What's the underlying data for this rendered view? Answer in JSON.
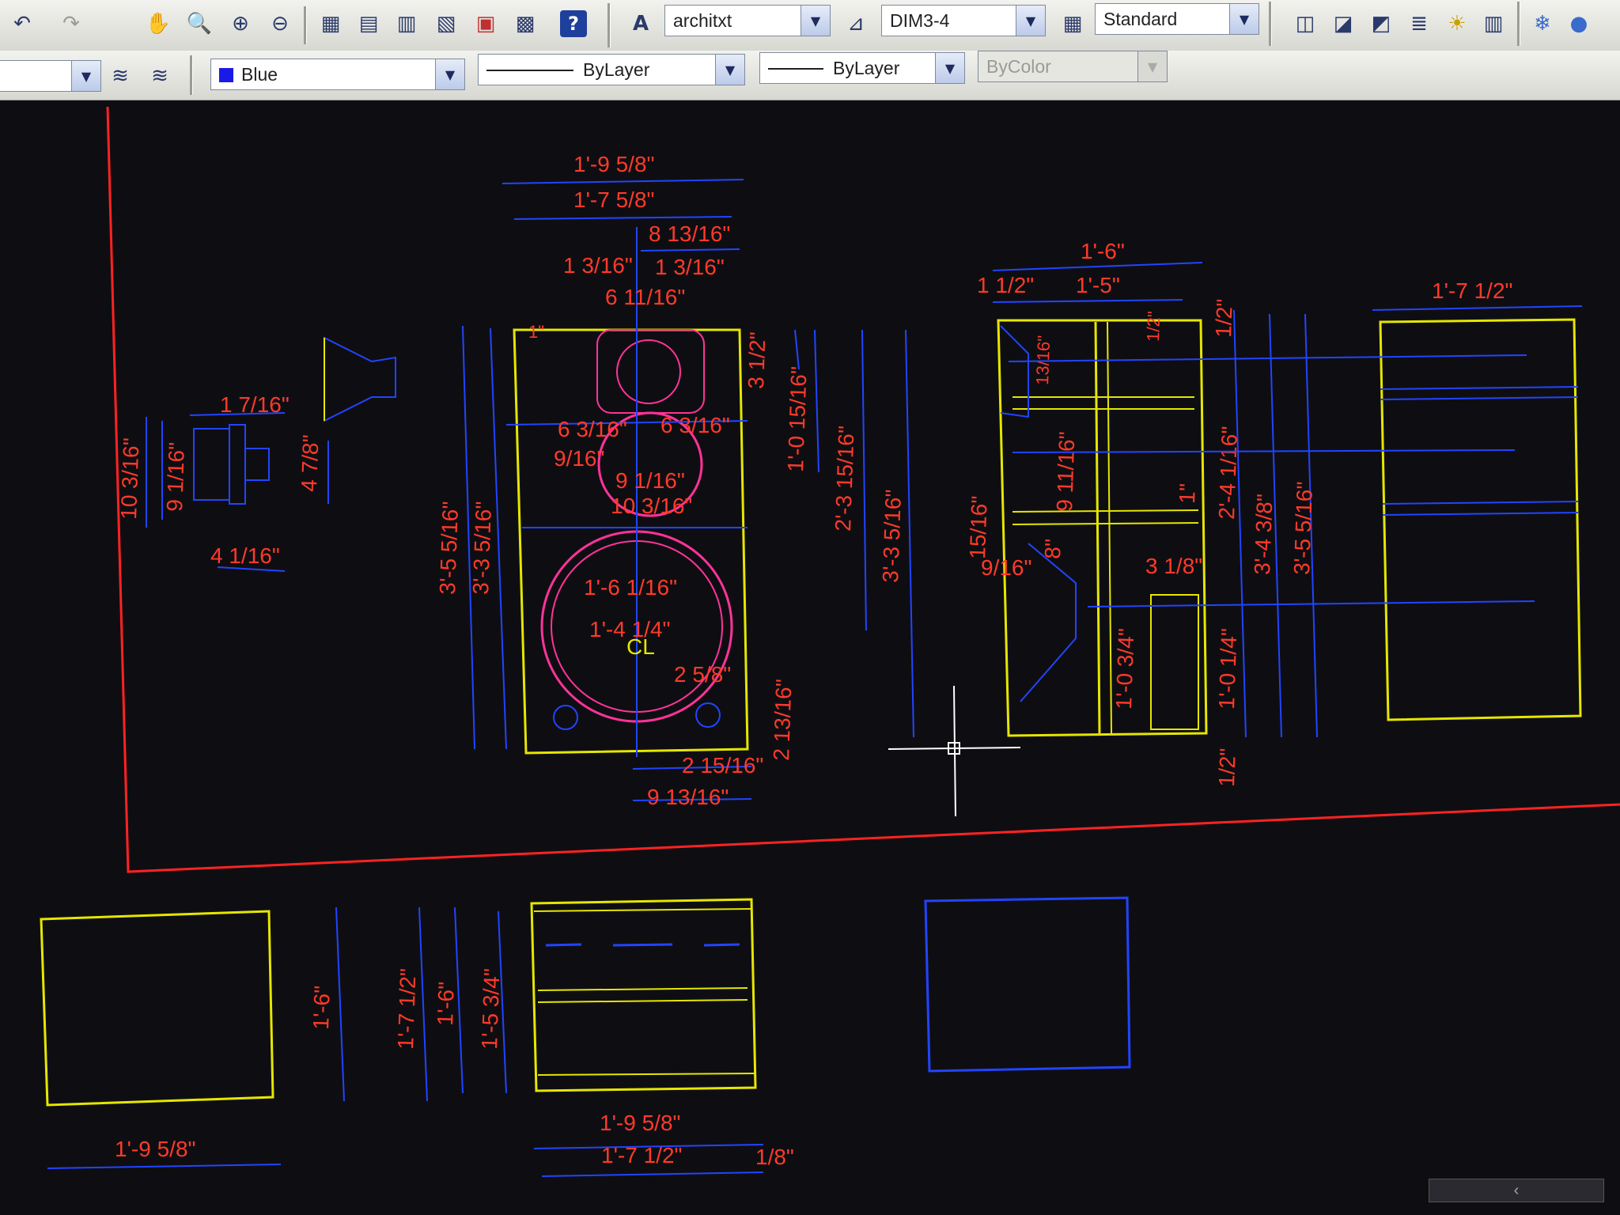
{
  "toolbar_top": {
    "text_style": "architxt",
    "dim_style": "DIM3-4",
    "table_style": "Standard"
  },
  "toolbar_props": {
    "layer": "",
    "color": "Blue",
    "color_swatch": "#1a1ae6",
    "linetype": "ByLayer",
    "lineweight": "ByLayer",
    "plotstyle": "ByColor"
  },
  "icons": [
    "undo-icon",
    "redo-icon",
    "pan-icon",
    "zoom-realtime-icon",
    "zoom-window-icon",
    "zoom-previous-icon",
    "properties-icon",
    "design-center-icon",
    "tool-palettes-icon",
    "sheet-set-icon",
    "markup-icon",
    "calculator-icon",
    "help-icon",
    "text-style-icon",
    "dim-style-icon",
    "table-style-icon",
    "layer-manager-icon",
    "layer-previous-icon",
    "layer-icon"
  ],
  "colors": {
    "dim_text": "#ff3a2a",
    "dim_line": "#2244ff",
    "object": "#e6e600",
    "border": "#ff2222",
    "background": "#0e0e12"
  },
  "dims": {
    "front_w1": "1'-9 5/8\"",
    "front_w2": "1'-7 5/8\"",
    "front_w3": "8 13/16\"",
    "front_a": "1 3/16\"",
    "front_b": "1 3/16\"",
    "front_c": "6 11/16\"",
    "front_d": "6 3/16\"",
    "front_e": "6 3/16\"",
    "front_f": "9/16\"",
    "front_g": "9 1/16\"",
    "front_h": "10 3/16\"",
    "front_i": "1'-6 1/16\"",
    "front_j": "1'-4 1/4\"",
    "front_cl": "CL",
    "front_k": "2 5/8\"",
    "front_l": "2 15/16\"",
    "front_m": "9 13/16\"",
    "front_n": "2 13/16\"",
    "front_h1": "3'-5 5/16\"",
    "front_h2": "3'-3 5/16\"",
    "front_r1": "3 1/2\"",
    "front_r2": "1'-0 15/16\"",
    "front_r3": "2'-3 15/16\"",
    "front_r4": "3'-3 5/16\"",
    "front_small": "1\"",
    "horn_a": "1 7/16\"",
    "horn_b": "10 3/16\"",
    "horn_c": "9 1/16\"",
    "horn_d": "4 7/8\"",
    "horn_e": "4 1/16\"",
    "side_a": "1'-6\"",
    "side_b": "1'-5\"",
    "side_c": "1 1/2\"",
    "side_d": "13/16\"",
    "side_e": "9 11/16\"",
    "side_f": "15/16\"",
    "side_g": "9/16\"",
    "side_h": "8\"",
    "side_i": "1'-0 3/4\"",
    "side_j": "3 1/8\"",
    "side_k": "1/2\"",
    "side_l": "1\"",
    "side_m": "2'-4 1/16\"",
    "side_n": "3'-4 3/8\"",
    "side_o": "3'-5 5/16\"",
    "side_p": "1'-0 1/4\"",
    "side_q": "1/2\"",
    "side_r": "1/2\"",
    "far_a": "1'-7 1/2\"",
    "bot1_w": "1'-9 5/8\"",
    "bot1_h": "1'-6\"",
    "bot2_a": "1'-7 1/2\"",
    "bot2_b": "1'-6\"",
    "bot2_c": "1'-5 3/4\"",
    "bot2_w1": "1'-9 5/8\"",
    "bot2_w2": "1'-7 1/2\"",
    "bot2_w3": "1/8\""
  }
}
